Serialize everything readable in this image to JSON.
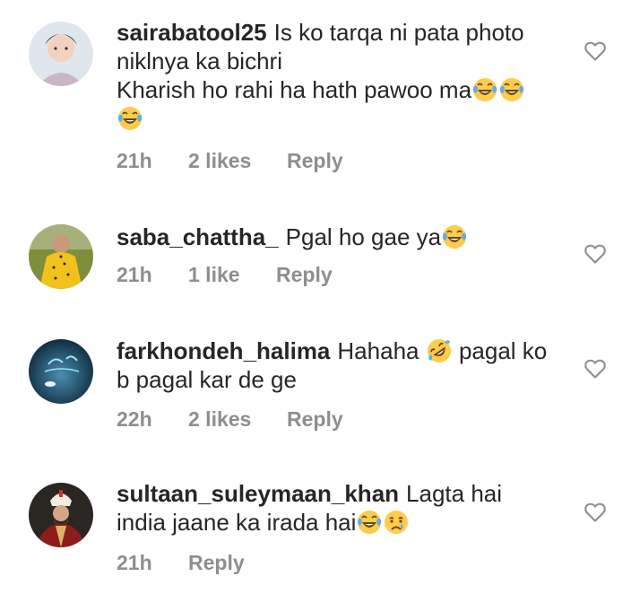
{
  "comments": [
    {
      "username": "sairabatool25",
      "text_line1": "Is ko tarqa ni pata photo",
      "text_line2": "niklnya ka bichri",
      "text_line3": "Kharish ho rahi ha hath pawoo ma",
      "emojis": [
        "face-with-tears-of-joy",
        "face-with-tears-of-joy",
        "face-with-tears-of-joy"
      ],
      "time": "21h",
      "likes": "2 likes",
      "reply": "Reply"
    },
    {
      "username": "saba_chattha_",
      "text_line1": "Pgal ho gae ya",
      "emojis": [
        "face-with-tears-of-joy"
      ],
      "time": "21h",
      "likes": "1 like",
      "reply": "Reply"
    },
    {
      "username": "farkhondeh_halima",
      "text_line1a": "Hahaha",
      "text_line1b": "pagal ko",
      "text_line2": "b pagal kar de ge",
      "emojis": [
        "rolling-on-the-floor-laughing"
      ],
      "time": "22h",
      "likes": "2 likes",
      "reply": "Reply"
    },
    {
      "username": "sultaan_suleymaan_khan",
      "text_line1": "Lagta hai",
      "text_line2": "india jaane ka irada hai",
      "emojis": [
        "face-with-tears-of-joy",
        "crying-face"
      ],
      "time": "21h",
      "reply": "Reply"
    }
  ],
  "icons": {
    "like": "heart-outline-icon"
  },
  "colors": {
    "text": "#262626",
    "meta": "#8e8e8e",
    "heart": "#8e8e8e",
    "emoji_yellow": "#FFCB4C",
    "tears_blue": "#5DADEC"
  }
}
